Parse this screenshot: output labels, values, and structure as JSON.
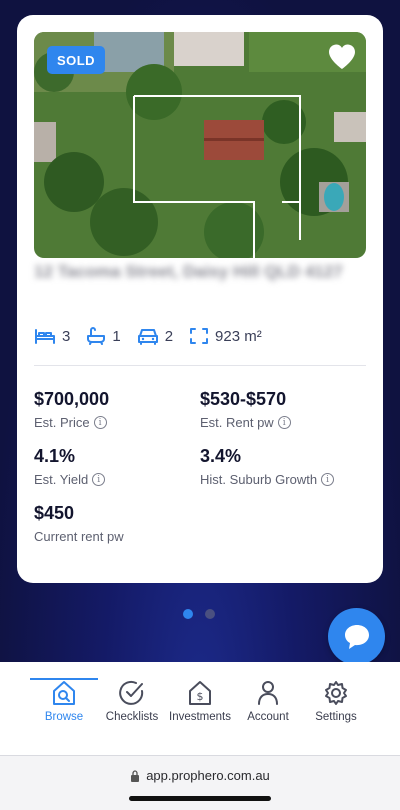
{
  "listing": {
    "badge": "SOLD",
    "address": "12 Tacoma Street, Daisy Hill QLD 4127",
    "features": {
      "beds": "3",
      "baths": "1",
      "cars": "2",
      "land": "923 m²"
    },
    "stats": {
      "price_value": "$700,000",
      "price_label": "Est. Price",
      "rent_value": "$530-$570",
      "rent_label": "Est. Rent pw",
      "yield_value": "4.1%",
      "yield_label": "Est. Yield",
      "growth_value": "3.4%",
      "growth_label": "Hist. Suburb Growth",
      "current_rent_value": "$450",
      "current_rent_label": "Current rent pw"
    }
  },
  "pagination": {
    "total": 2,
    "active_index": 0
  },
  "tabs": [
    {
      "label": "Browse",
      "icon": "house-search-icon",
      "active": true
    },
    {
      "label": "Checklists",
      "icon": "check-circle-icon",
      "active": false
    },
    {
      "label": "Investments",
      "icon": "house-dollar-icon",
      "active": false
    },
    {
      "label": "Account",
      "icon": "person-icon",
      "active": false
    },
    {
      "label": "Settings",
      "icon": "gear-icon",
      "active": false
    }
  ],
  "browser": {
    "url": "app.prophero.com.au"
  },
  "colors": {
    "accent": "#2f86ee",
    "background": "#0f1240",
    "text": "#13152e"
  }
}
